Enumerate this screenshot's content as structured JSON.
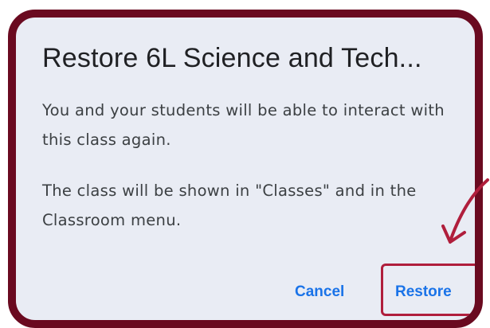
{
  "dialog": {
    "title": "Restore 6L Science and Tech...",
    "message_1": "You and your students will be able to interact with this class again.",
    "message_2": "The class will be shown in \"Classes\" and in the Classroom menu.",
    "cancel_label": "Cancel",
    "restore_label": "Restore"
  },
  "colors": {
    "frame_border": "#6a0a20",
    "dialog_background": "#e9ecf4",
    "button_text": "#1a73e8",
    "annotation": "#b01e3c"
  },
  "icons": {
    "annotation_arrow": "curved-arrow-icon"
  }
}
